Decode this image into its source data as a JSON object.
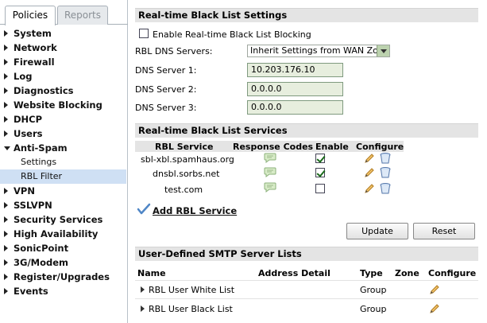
{
  "tabs": {
    "policies": "Policies",
    "reports": "Reports"
  },
  "nav": [
    {
      "label": "System",
      "expanded": false
    },
    {
      "label": "Network",
      "expanded": false
    },
    {
      "label": "Firewall",
      "expanded": false
    },
    {
      "label": "Log",
      "expanded": false
    },
    {
      "label": "Diagnostics",
      "expanded": false
    },
    {
      "label": "Website Blocking",
      "expanded": false
    },
    {
      "label": "DHCP",
      "expanded": false
    },
    {
      "label": "Users",
      "expanded": false
    },
    {
      "label": "Anti-Spam",
      "expanded": true
    },
    {
      "label": "Settings",
      "sub": true
    },
    {
      "label": "RBL Filter",
      "sub": true,
      "selected": true
    },
    {
      "label": "VPN",
      "expanded": false
    },
    {
      "label": "SSLVPN",
      "expanded": false
    },
    {
      "label": "Security Services",
      "expanded": false
    },
    {
      "label": "High Availability",
      "expanded": false
    },
    {
      "label": "SonicPoint",
      "expanded": false
    },
    {
      "label": "3G/Modem",
      "expanded": false
    },
    {
      "label": "Register/Upgrades",
      "expanded": false
    },
    {
      "label": "Events",
      "expanded": false
    }
  ],
  "rbl_settings": {
    "heading": "Real-time Black List Settings",
    "enable_label": "Enable Real-time Black List Blocking",
    "enable_checked": false,
    "dns_servers_label": "RBL DNS Servers:",
    "dns_servers_value": "Inherit Settings from WAN Zone",
    "dns1_label": "DNS Server 1:",
    "dns1_value": "10.203.176.10",
    "dns2_label": "DNS Server 2:",
    "dns2_value": "0.0.0.0",
    "dns3_label": "DNS Server 3:",
    "dns3_value": "0.0.0.0"
  },
  "rbl_services": {
    "heading": "Real-time Black List Services",
    "columns": {
      "service": "RBL Service",
      "codes": "Response Codes",
      "enable": "Enable",
      "configure": "Configure"
    },
    "rows": [
      {
        "service": "sbl-xbl.spamhaus.org",
        "enabled": true
      },
      {
        "service": "dnsbl.sorbs.net",
        "enabled": true
      },
      {
        "service": "test.com",
        "enabled": false
      }
    ],
    "add_label": "Add RBL Service",
    "update_label": "Update",
    "reset_label": "Reset"
  },
  "smtp_lists": {
    "heading": "User-Defined SMTP Server Lists",
    "columns": {
      "name": "Name",
      "address": "Address Detail",
      "type": "Type",
      "zone": "Zone",
      "configure": "Configure"
    },
    "rows": [
      {
        "name": "RBL User White List",
        "type": "Group",
        "zone": ""
      },
      {
        "name": "RBL User Black List",
        "type": "Group",
        "zone": ""
      }
    ]
  },
  "colors": {
    "selected_bg": "#cfe0f4",
    "section_bg": "#e4e4e4",
    "field_bg": "#e7eede",
    "checkmark": "#1a6a1a"
  },
  "icons": [
    "speech-bubble-icon",
    "pencil-icon",
    "trash-icon",
    "checkmark-icon",
    "expand-arrow-icon"
  ]
}
